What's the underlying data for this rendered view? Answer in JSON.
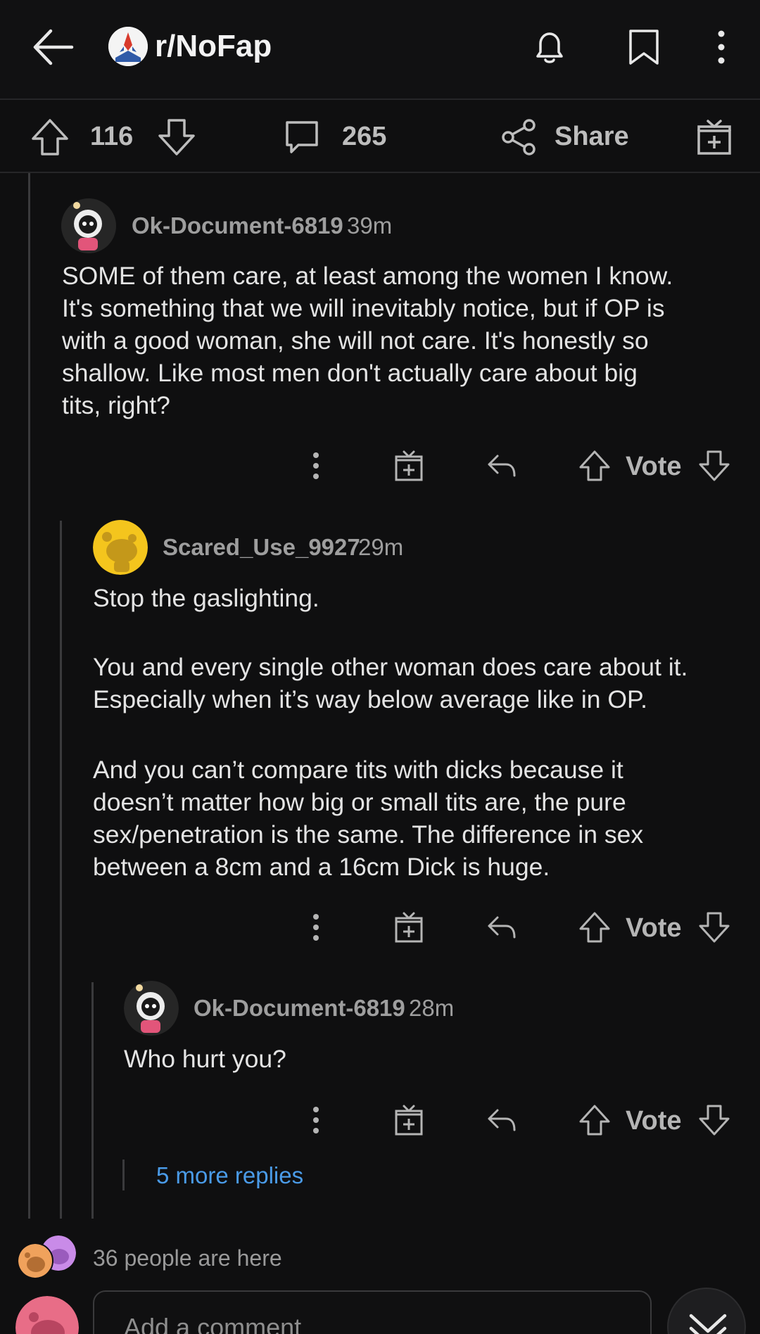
{
  "header": {
    "subreddit": "r/NoFap",
    "icons": [
      "back-arrow-icon",
      "bell-icon",
      "bookmark-icon",
      "more-vertical-icon"
    ]
  },
  "actionbar": {
    "upvotes": "116",
    "comments": "265",
    "share_label": "Share"
  },
  "comments": [
    {
      "author": "Ok-Document-6819",
      "time": "39m",
      "body": [
        "SOME of them care, at least among the women I know.",
        "It's something that we will inevitably notice, but if OP is",
        "with a good woman, she will not care. It's honestly so",
        "shallow. Like most men don't actually care about big",
        "tits, right?"
      ],
      "vote_label": "Vote"
    },
    {
      "author": "Scared_Use_9927",
      "time": "29m",
      "body": [
        "Stop the gaslighting.",
        "",
        "You and every single other woman does care about it.",
        "Especially when it’s way below average like in OP.",
        "",
        "And you can’t compare tits with dicks because it",
        "doesn’t matter how big or small tits are, the pure",
        "sex/penetration is the same. The difference in sex",
        "between a 8cm and a 16cm Dick is huge."
      ],
      "vote_label": "Vote"
    },
    {
      "author": "Ok-Document-6819",
      "time": "28m",
      "body": [
        "Who hurt you?"
      ],
      "vote_label": "Vote"
    }
  ],
  "more_replies": "5 more replies",
  "presence": "36 people are here",
  "composer": {
    "placeholder": "Add a comment"
  },
  "colors": {
    "background": "#0f0f10",
    "link": "#4a9be8",
    "snoo_yellow": "#f4c51d",
    "avatar_pink": "#e2557a"
  }
}
